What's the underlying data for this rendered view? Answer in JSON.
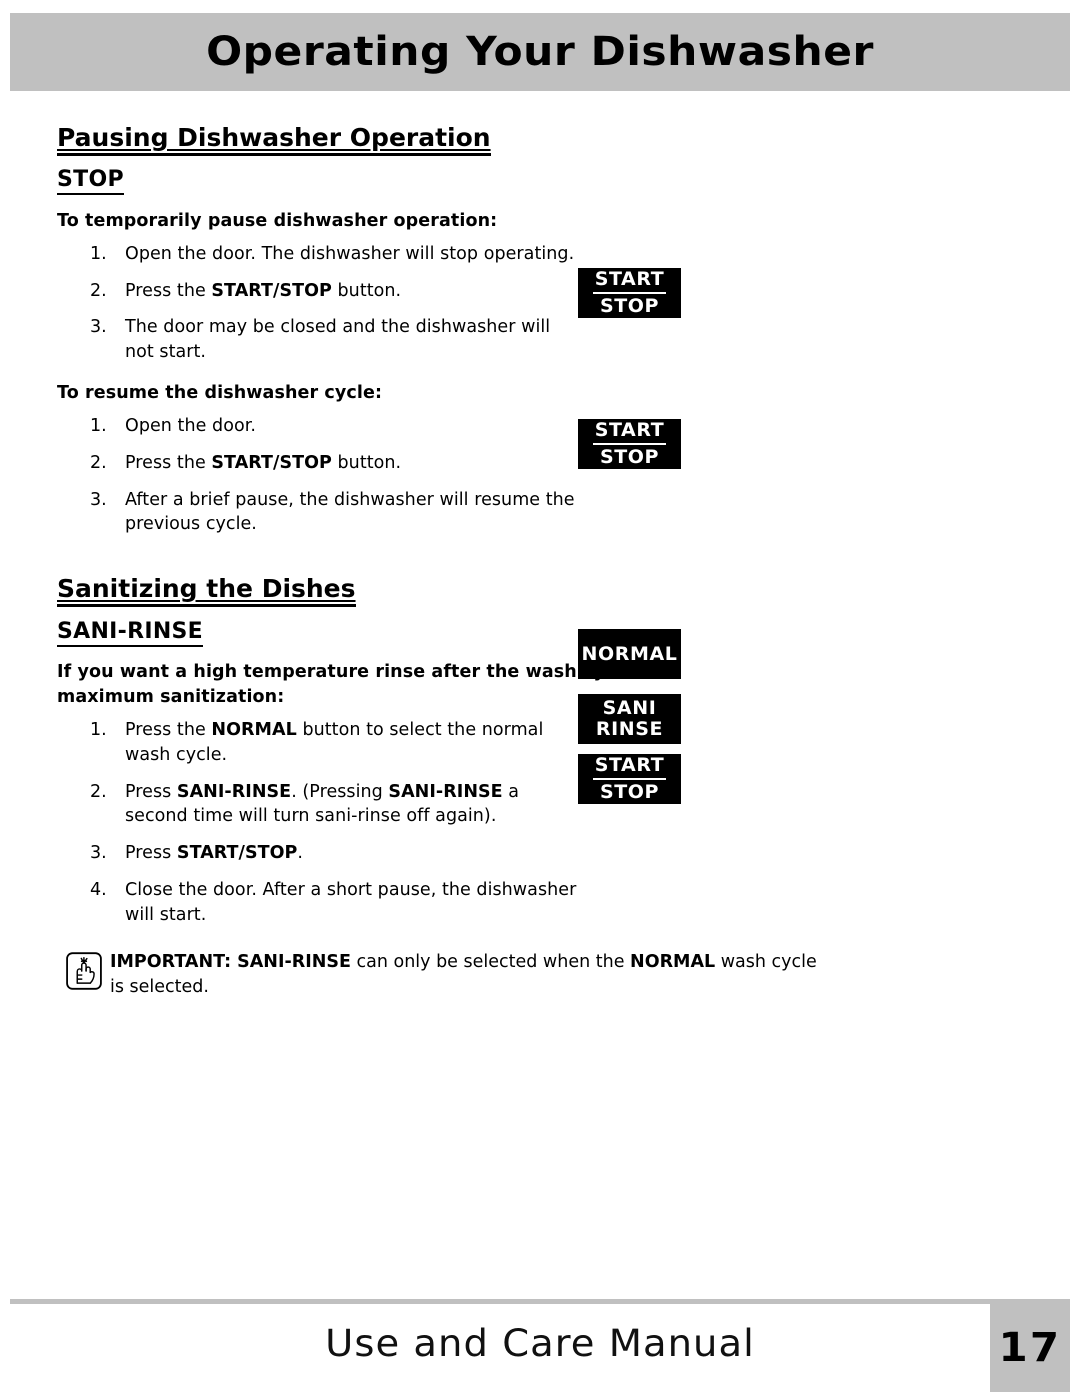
{
  "header": {
    "title": "Operating Your Dishwasher"
  },
  "sections": [
    {
      "heading": "Pausing Dishwasher Operation",
      "subheading": "STOP",
      "groups": [
        {
          "lead": "To temporarily pause dishwasher operation:",
          "steps": [
            {
              "num": "1.",
              "parts": [
                {
                  "t": "Open the door. The dishwasher will stop operating.",
                  "b": false
                }
              ]
            },
            {
              "num": "2.",
              "parts": [
                {
                  "t": "Press the ",
                  "b": false
                },
                {
                  "t": "START/STOP",
                  "b": true
                },
                {
                  "t": " button.",
                  "b": false
                }
              ]
            },
            {
              "num": "3.",
              "parts": [
                {
                  "t": "The door may be closed and the dishwasher will not start.",
                  "b": false
                }
              ]
            }
          ]
        },
        {
          "lead": "To resume the dishwasher cycle:",
          "steps": [
            {
              "num": "1.",
              "parts": [
                {
                  "t": "Open the door.",
                  "b": false
                }
              ]
            },
            {
              "num": "2.",
              "parts": [
                {
                  "t": "Press the ",
                  "b": false
                },
                {
                  "t": "START/STOP",
                  "b": true
                },
                {
                  "t": " button.",
                  "b": false
                }
              ]
            },
            {
              "num": "3.",
              "parts": [
                {
                  "t": "After a brief pause, the dishwasher will resume the previous cycle.",
                  "b": false
                }
              ]
            }
          ]
        }
      ]
    },
    {
      "heading": "Sanitizing the Dishes",
      "subheading": "SANI-RINSE",
      "groups": [
        {
          "lead": "If you want a high temperature rinse after the wash cycle for maximum sanitization:",
          "steps": [
            {
              "num": "1.",
              "parts": [
                {
                  "t": "Press the ",
                  "b": false
                },
                {
                  "t": "NORMAL",
                  "b": true
                },
                {
                  "t": " button to select the normal wash cycle.",
                  "b": false
                }
              ]
            },
            {
              "num": "2.",
              "parts": [
                {
                  "t": "Press ",
                  "b": false
                },
                {
                  "t": "SANI-RINSE",
                  "b": true
                },
                {
                  "t": ". (Pressing ",
                  "b": false
                },
                {
                  "t": "SANI-RINSE",
                  "b": true
                },
                {
                  "t": " a second time will turn sani-rinse off again).",
                  "b": false
                }
              ]
            },
            {
              "num": "3.",
              "parts": [
                {
                  "t": "Press ",
                  "b": false
                },
                {
                  "t": "START/STOP",
                  "b": true
                },
                {
                  "t": ".",
                  "b": false
                }
              ]
            },
            {
              "num": "4.",
              "parts": [
                {
                  "t": "Close the door. After a short pause, the dishwasher will start.",
                  "b": false
                }
              ]
            }
          ]
        }
      ]
    }
  ],
  "important_note": {
    "icon": "hand-with-string-reminder-icon",
    "parts": [
      {
        "t": "IMPORTANT: SANI-RINSE",
        "b": true
      },
      {
        "t": " can only be selected when the ",
        "b": false
      },
      {
        "t": "NORMAL",
        "b": true
      },
      {
        "t": " wash cycle is selected.",
        "b": false
      }
    ]
  },
  "buttons": [
    {
      "id": "btn-startstop-1",
      "line1": "START",
      "line2": "STOP",
      "divider": true
    },
    {
      "id": "btn-startstop-2",
      "line1": "START",
      "line2": "STOP",
      "divider": true
    },
    {
      "id": "btn-normal",
      "line1": "NORMAL",
      "line2": "",
      "divider": false
    },
    {
      "id": "btn-sanirinse",
      "line1": "SANI",
      "line2": "RINSE",
      "divider": false
    },
    {
      "id": "btn-startstop-3",
      "line1": "START",
      "line2": "STOP",
      "divider": true
    }
  ],
  "footer": {
    "text": "Use and Care Manual",
    "page_number": "17"
  },
  "colors": {
    "banner_gray": "#c0c0c0",
    "button_black": "#000000",
    "button_text": "#ffffff",
    "body_text": "#000000"
  }
}
